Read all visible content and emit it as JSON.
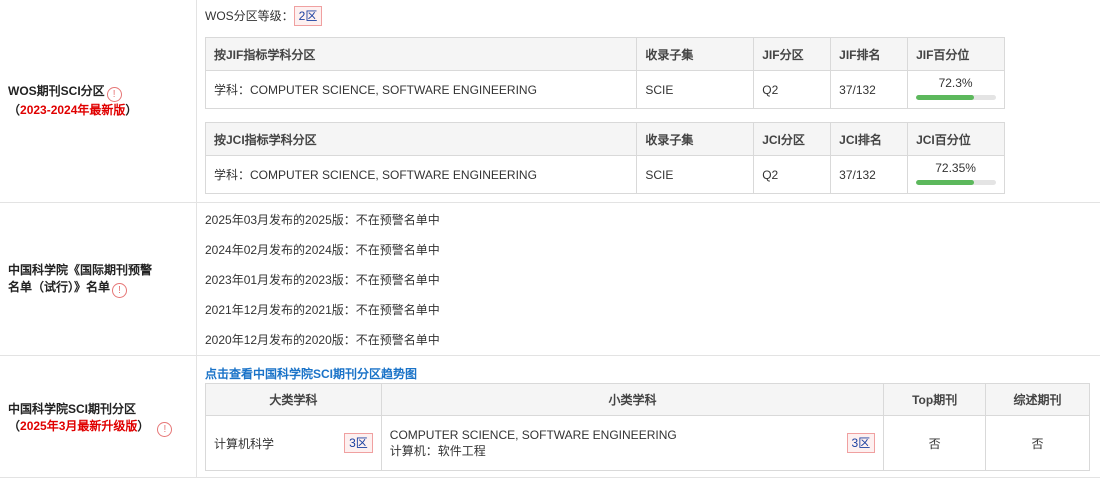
{
  "wos": {
    "label_line1": "WOS期刊SCI分区",
    "label_line2_prefix": "（",
    "label_line2_red": "2023-2024年最新版",
    "label_line2_suffix": "）",
    "info_icon": "info-icon",
    "level_label": "WOS分区等级：",
    "level_value": "2区",
    "jif_table": {
      "headers": [
        "按JIF指标学科分区",
        "收录子集",
        "JIF分区",
        "JIF排名",
        "JIF百分位"
      ],
      "subject": "学科：COMPUTER SCIENCE, SOFTWARE ENGINEERING",
      "subset": "SCIE",
      "zone": "Q2",
      "rank": "37/132",
      "percentile": "72.3%",
      "percentile_value": 72.3
    },
    "jci_table": {
      "headers": [
        "按JCI指标学科分区",
        "收录子集",
        "JCI分区",
        "JCI排名",
        "JCI百分位"
      ],
      "subject": "学科：COMPUTER SCIENCE, SOFTWARE ENGINEERING",
      "subset": "SCIE",
      "zone": "Q2",
      "rank": "37/132",
      "percentile": "72.35%",
      "percentile_value": 72.35
    }
  },
  "warning": {
    "label_line1": "中国科学院《国际期刊预警",
    "label_line2": "名单（试行）》名单",
    "lines": [
      "2025年03月发布的2025版：不在预警名单中",
      "2024年02月发布的2024版：不在预警名单中",
      "2023年01月发布的2023版：不在预警名单中",
      "2021年12月发布的2021版：不在预警名单中",
      "2020年12月发布的2020版：不在预警名单中"
    ]
  },
  "cas": {
    "label_line1": "中国科学院SCI期刊分区",
    "label_line2_prefix": "（",
    "label_line2_red": "2025年3月最新升级版",
    "label_line2_suffix": "）",
    "trend_link": "点击查看中国科学院SCI期刊分区趋势图",
    "headers": [
      "大类学科",
      "小类学科",
      "Top期刊",
      "综述期刊"
    ],
    "major_subject": "计算机科学",
    "major_zone": "3区",
    "minor_subject_en": "COMPUTER SCIENCE, SOFTWARE ENGINEERING",
    "minor_subject_cn": "计算机：软件工程",
    "minor_zone": "3区",
    "top": "否",
    "review": "否"
  }
}
